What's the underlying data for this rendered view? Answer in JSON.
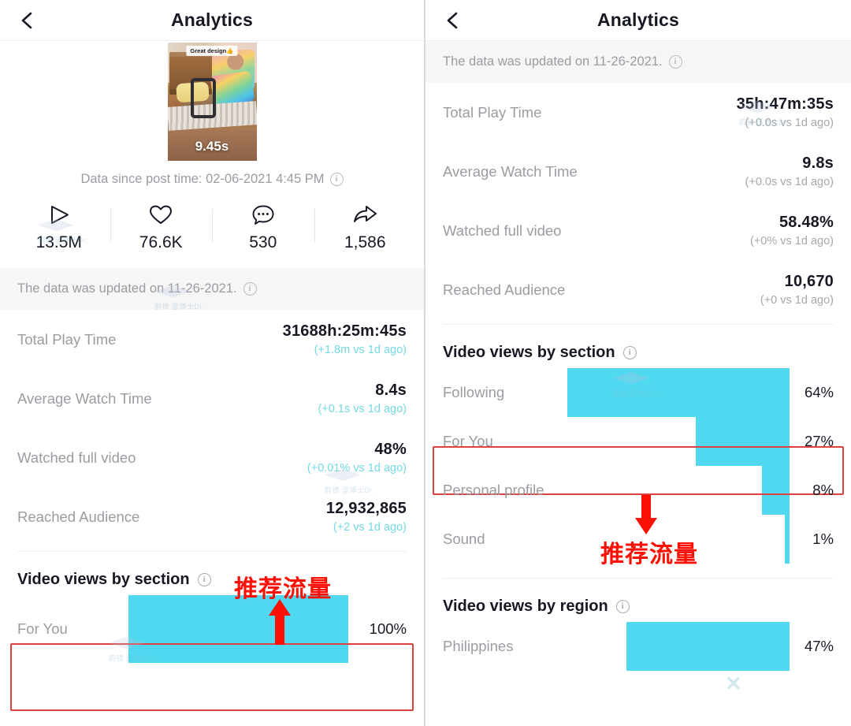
{
  "left": {
    "header": {
      "title": "Analytics",
      "back_icon": "chevron-left-icon"
    },
    "thumbnail": {
      "caption": "Great design👍",
      "duration": "9.45s"
    },
    "since_text": "Data since post time: 02-06-2021 4:45 PM",
    "engagement": [
      {
        "icon": "play-icon",
        "value": "13.5M"
      },
      {
        "icon": "heart-icon",
        "value": "76.6K"
      },
      {
        "icon": "comment-icon",
        "value": "530"
      },
      {
        "icon": "share-icon",
        "value": "1,586"
      }
    ],
    "updated_text": "The data was updated on 11-26-2021.",
    "metrics": [
      {
        "label": "Total Play Time",
        "value": "31688h:25m:45s",
        "delta": "(+1.8m vs 1d ago)"
      },
      {
        "label": "Average Watch Time",
        "value": "8.4s",
        "delta": "(+0.1s vs 1d ago)"
      },
      {
        "label": "Watched full video",
        "value": "48%",
        "delta": "(+0.01% vs 1d ago)"
      },
      {
        "label": "Reached Audience",
        "value": "12,932,865",
        "delta": "(+2 vs 1d ago)"
      }
    ],
    "section_title": "Video views by section",
    "annotation": {
      "text": "推荐流量",
      "arrow": "arrow-up"
    }
  },
  "right": {
    "header": {
      "title": "Analytics",
      "back_icon": "chevron-left-icon"
    },
    "updated_text": "The data was updated on 11-26-2021.",
    "metrics": [
      {
        "label": "Total Play Time",
        "value": "35h:47m:35s",
        "delta": "(+0.0s vs 1d ago)"
      },
      {
        "label": "Average Watch Time",
        "value": "9.8s",
        "delta": "(+0.0s vs 1d ago)"
      },
      {
        "label": "Watched full video",
        "value": "58.48%",
        "delta": "(+0% vs 1d ago)"
      },
      {
        "label": "Reached Audience",
        "value": "10,670",
        "delta": "(+0 vs 1d ago)"
      }
    ],
    "section_title": "Video views by section",
    "region_title": "Video views by region",
    "annotation": {
      "text": "推荐流量",
      "arrow": "arrow-down"
    }
  },
  "watermark": {
    "text": "韵镜 蓝博士Dr.",
    "logo": "graduation-cap-icon"
  },
  "colors": {
    "bar": "#4fd8ef",
    "delta_teal": "#76d9e2",
    "delta_gray": "#a6a8ad",
    "annotation_red": "#fc1006",
    "redbox": "#e0403f",
    "text_primary": "#161823",
    "text_muted": "#9a9ca2"
  },
  "chart_data": [
    {
      "type": "bar",
      "title": "Video views by section",
      "orientation": "horizontal",
      "panel": "left",
      "categories": [
        "For You"
      ],
      "values": [
        100
      ],
      "value_labels": [
        "100%"
      ],
      "xlabel": "",
      "ylabel": "",
      "xlim": [
        0,
        100
      ],
      "grid": false,
      "legend": false
    },
    {
      "type": "bar",
      "title": "Video views by section",
      "orientation": "horizontal",
      "panel": "right",
      "categories": [
        "Following",
        "For You",
        "Personal profile",
        "Sound"
      ],
      "values": [
        64,
        27,
        8,
        1
      ],
      "value_labels": [
        "64%",
        "27%",
        "8%",
        "1%"
      ],
      "xlabel": "",
      "ylabel": "",
      "xlim": [
        0,
        100
      ],
      "grid": false,
      "legend": false
    },
    {
      "type": "bar",
      "title": "Video views by region",
      "orientation": "horizontal",
      "panel": "right",
      "categories": [
        "Philippines"
      ],
      "values": [
        47
      ],
      "value_labels": [
        "47%"
      ],
      "xlabel": "",
      "ylabel": "",
      "xlim": [
        0,
        100
      ],
      "grid": false,
      "legend": false
    }
  ]
}
